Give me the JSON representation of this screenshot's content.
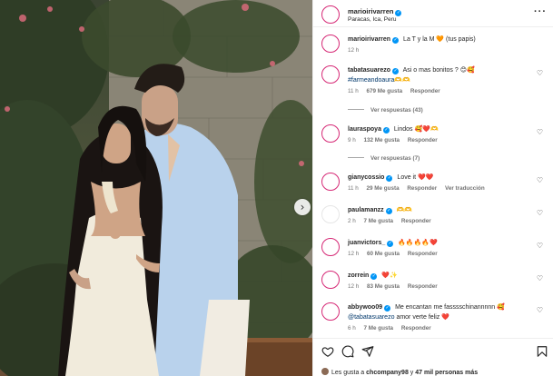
{
  "post": {
    "author": "marioirivarren",
    "location": "Paracas, Ica, Peru",
    "caption_text": "La T y la M",
    "caption_emoji": "🧡",
    "caption_suffix": "(tus papis)",
    "caption_time": "12 h"
  },
  "comments": [
    {
      "user": "tabatasuarezo",
      "verified": true,
      "text": "Asi o mas bonitos ?",
      "emoji": "😊🥰",
      "hashtag": "#farmeandoaura",
      "hashtag_suffix": "🫶🫶",
      "time": "11 h",
      "likes": "679 Me gusta",
      "reply": "Responder",
      "replies": "Ver respuestas (43)"
    },
    {
      "user": "lauraspoya",
      "verified": true,
      "text": "Lindos",
      "emoji": "🥰❤️🫶",
      "time": "9 h",
      "likes": "132 Me gusta",
      "reply": "Responder",
      "replies": "Ver respuestas (7)"
    },
    {
      "user": "gianycossio",
      "verified": true,
      "text": "Love it",
      "emoji": "❤️❤️",
      "time": "11 h",
      "likes": "29 Me gusta",
      "reply": "Responder",
      "translate": "Ver traducción"
    },
    {
      "user": "paulamanzz",
      "verified": true,
      "text": "",
      "emoji": "🫶🫶",
      "time": "2 h",
      "likes": "7 Me gusta",
      "reply": "Responder"
    },
    {
      "user": "juanvictors_",
      "verified": true,
      "text": "",
      "emoji": "🔥🔥🔥🔥❤️",
      "time": "12 h",
      "likes": "60 Me gusta",
      "reply": "Responder"
    },
    {
      "user": "zorrein",
      "verified": true,
      "text": "",
      "emoji": "❤️✨",
      "time": "12 h",
      "likes": "83 Me gusta",
      "reply": "Responder"
    },
    {
      "user": "abbywoo09",
      "verified": true,
      "text": "Me encantan me fasssschinannnnn",
      "emoji": "🥰",
      "mention": "@tabatasuarezo",
      "text2": "amor verte feliz",
      "emoji2": "❤️",
      "time": "6 h",
      "likes": "7 Me gusta",
      "reply": "Responder"
    }
  ],
  "likes_bar": {
    "prefix": "Les gusta a",
    "user": "chcompany98",
    "middle": "y",
    "count": "47 mil personas más"
  },
  "icons": {
    "more": "more-icon",
    "heart": "heart-icon",
    "comment": "comment-icon",
    "share": "share-icon",
    "save": "save-icon",
    "next": "chevron-right-icon"
  },
  "colors": {
    "verified": "#0095f6",
    "link": "#00376b",
    "muted": "#737373"
  }
}
